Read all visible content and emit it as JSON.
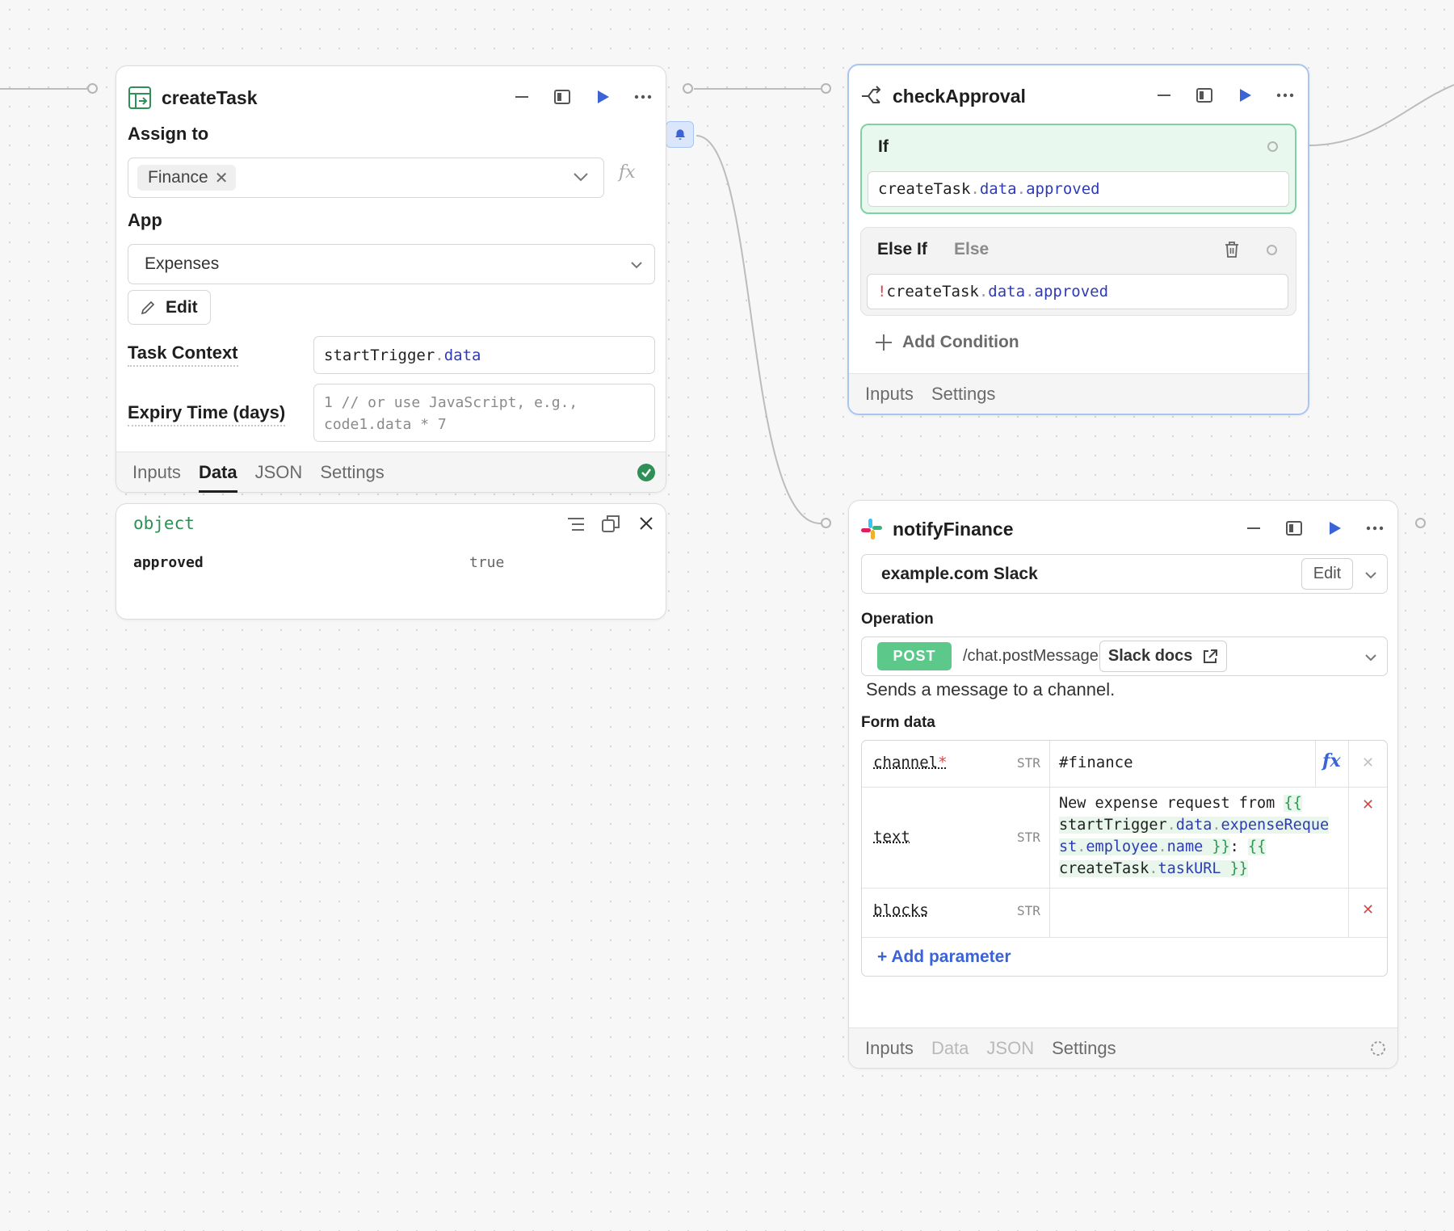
{
  "colors": {
    "accent_blue": "#3b63d6",
    "success_green": "#2e8f57",
    "post_badge": "#5cc98a",
    "selected_border": "#a9c5f2",
    "if_border": "#7fd3a0",
    "if_bg": "#e9f8ef"
  },
  "createTask": {
    "title": "createTask",
    "assign_to_label": "Assign to",
    "assign_to_tag": "Finance",
    "app_label": "App",
    "app_value": "Expenses",
    "edit_label": "Edit",
    "task_context_label": "Task Context",
    "task_context_obj": "startTrigger",
    "task_context_sep": ".",
    "task_context_prop": "data",
    "expiry_label": "Expiry Time (days)",
    "expiry_placeholder_line1": "1 // or use JavaScript, e.g.,",
    "expiry_placeholder_line2": "code1.data * 7",
    "fx_label": "fx",
    "tabs": [
      "Inputs",
      "Data",
      "JSON",
      "Settings"
    ],
    "active_tab": "Data",
    "status": "success"
  },
  "dataPanel": {
    "type_label": "object",
    "key": "approved",
    "value": "true"
  },
  "checkApproval": {
    "title": "checkApproval",
    "if_label": "If",
    "if_expr": [
      "createTask",
      ".",
      "data",
      ".",
      "approved"
    ],
    "else_if_label": "Else If",
    "else_label": "Else",
    "else_if_expr_bang": "!",
    "else_if_expr": [
      "createTask",
      ".",
      "data",
      ".",
      "approved"
    ],
    "add_condition_label": "Add Condition",
    "tabs": [
      "Inputs",
      "Settings"
    ]
  },
  "notifyFinance": {
    "title": "notifyFinance",
    "resource": "example.com Slack",
    "edit_label": "Edit",
    "operation_label": "Operation",
    "method": "POST",
    "endpoint": "/chat.postMessage",
    "docs_label": "Slack docs",
    "description": "Sends a message to a channel.",
    "form_data_label": "Form data",
    "params": [
      {
        "name": "channel",
        "required": "*",
        "type": "STR",
        "value": "#finance"
      },
      {
        "name": "text",
        "type": "STR",
        "v1": "New expense request from ",
        "v2": "{{",
        "v3": "startTrigger",
        "v4": ".",
        "v5": "data",
        "v6": ".",
        "v7": "expenseReque",
        "v8": "st",
        "v9": ".",
        "v10": "employee",
        "v11": ".",
        "v12": "name",
        "v13": " }}",
        "v14": ": ",
        "v15": "{{",
        "v16": "createTask",
        "v17": ".",
        "v18": "taskURL",
        "v19": " }}"
      },
      {
        "name": "blocks",
        "type": "STR",
        "value": ""
      }
    ],
    "add_param_label": "+ Add parameter",
    "fx_label": "fx",
    "tabs": [
      "Inputs",
      "Data",
      "JSON",
      "Settings"
    ]
  }
}
